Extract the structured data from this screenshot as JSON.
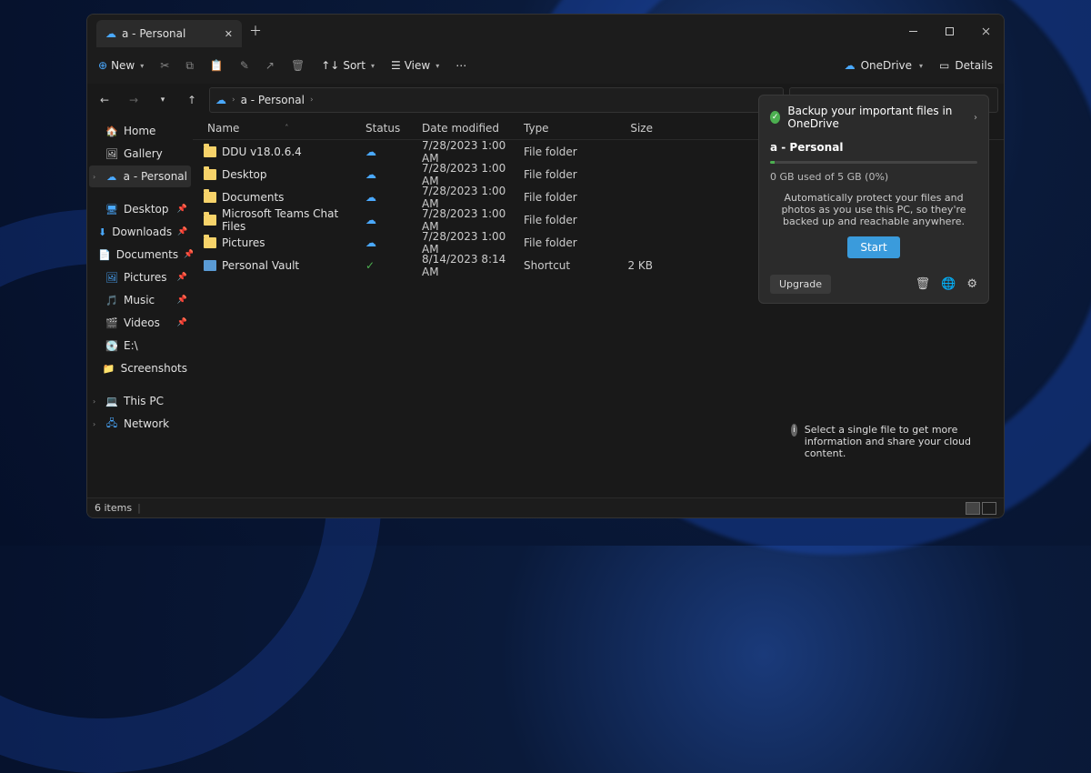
{
  "titlebar": {
    "tab_title": "a - Personal"
  },
  "toolbar": {
    "new": "New",
    "sort": "Sort",
    "view": "View",
    "onedrive": "OneDrive",
    "details": "Details"
  },
  "crumb": {
    "root": "a - Personal"
  },
  "sidebar": {
    "home": "Home",
    "gallery": "Gallery",
    "apersonal": "a - Personal",
    "desktop": "Desktop",
    "downloads": "Downloads",
    "documents": "Documents",
    "pictures": "Pictures",
    "music": "Music",
    "videos": "Videos",
    "drive": "E:\\",
    "screenshots": "Screenshots",
    "thispc": "This PC",
    "network": "Network"
  },
  "columns": {
    "name": "Name",
    "status": "Status",
    "date": "Date modified",
    "type": "Type",
    "size": "Size"
  },
  "files": [
    {
      "name": "DDU v18.0.6.4",
      "status": "cloud",
      "date": "7/28/2023 1:00 AM",
      "type": "File folder",
      "size": ""
    },
    {
      "name": "Desktop",
      "status": "cloud",
      "date": "7/28/2023 1:00 AM",
      "type": "File folder",
      "size": ""
    },
    {
      "name": "Documents",
      "status": "cloud",
      "date": "7/28/2023 1:00 AM",
      "type": "File folder",
      "size": ""
    },
    {
      "name": "Microsoft Teams Chat Files",
      "status": "cloud",
      "date": "7/28/2023 1:00 AM",
      "type": "File folder",
      "size": ""
    },
    {
      "name": "Pictures",
      "status": "cloud",
      "date": "7/28/2023 1:00 AM",
      "type": "File folder",
      "size": ""
    },
    {
      "name": "Personal Vault",
      "status": "ok",
      "date": "8/14/2023 8:14 AM",
      "type": "Shortcut",
      "size": "2 KB"
    }
  ],
  "flyout": {
    "header": "Backup your important files in OneDrive",
    "title": "a - Personal",
    "usage": "0 GB used of 5 GB (0%)",
    "desc": "Automatically protect your files and photos as you use this PC, so they're backed up and reachable anywhere.",
    "start": "Start",
    "upgrade": "Upgrade"
  },
  "hint": "Select a single file to get more information and share your cloud content.",
  "status": "6 items"
}
